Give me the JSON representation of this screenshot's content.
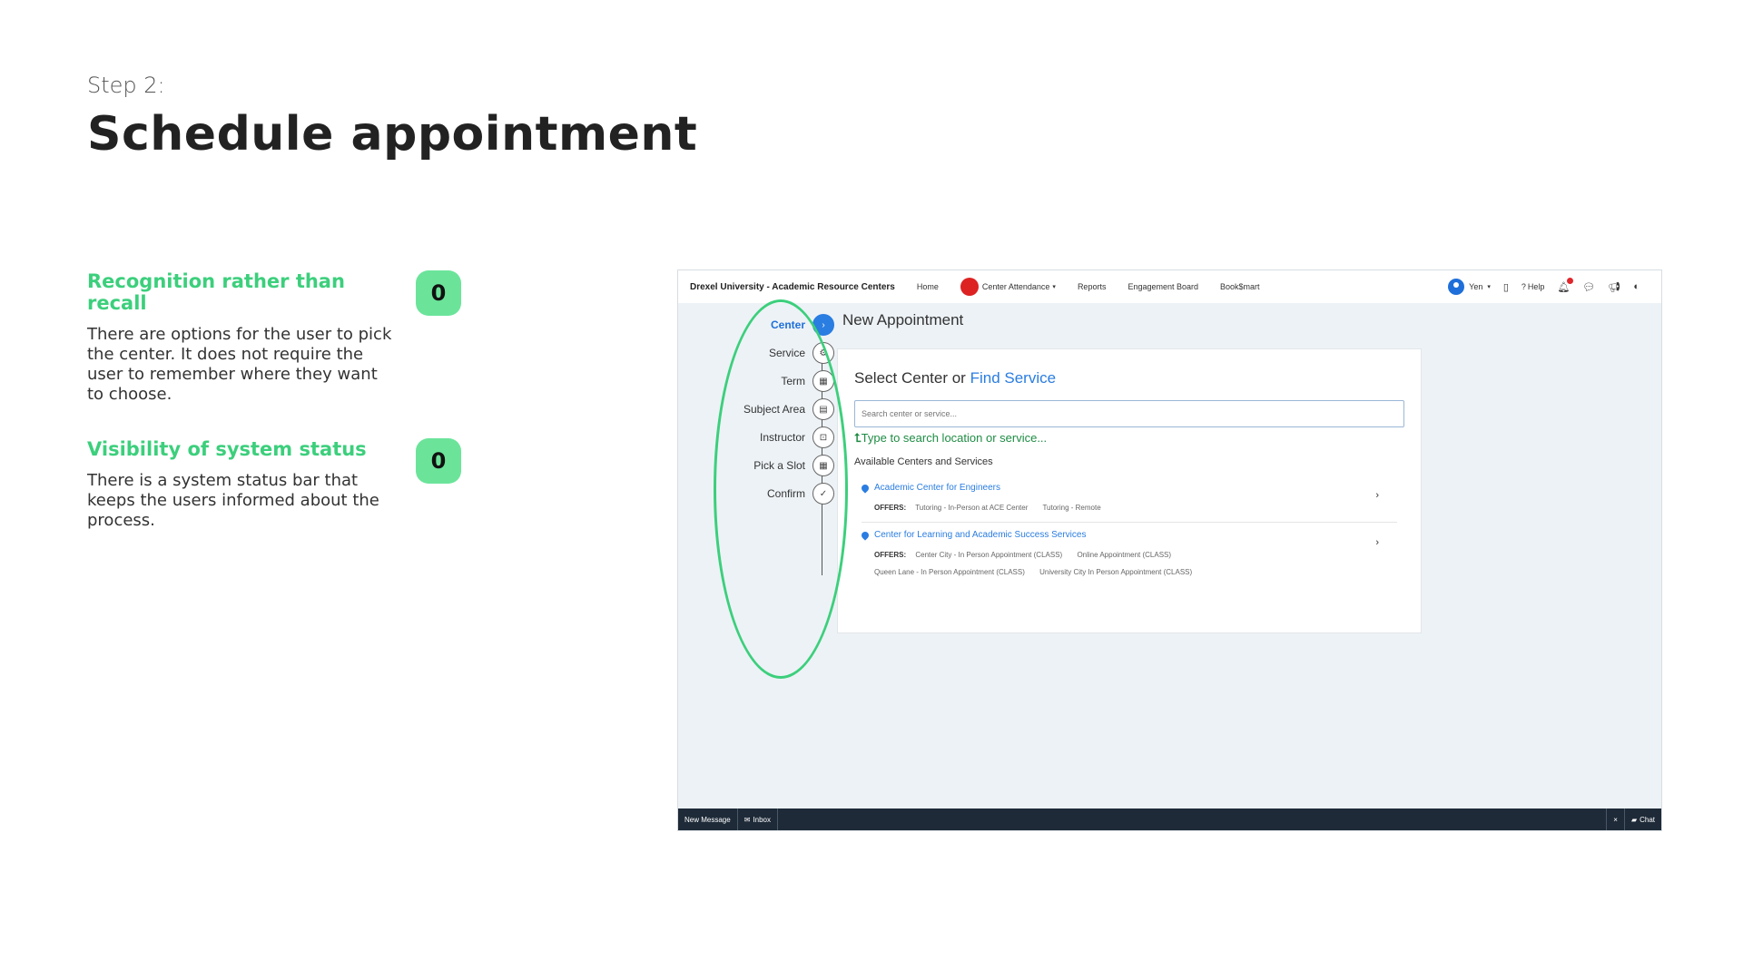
{
  "slide": {
    "step_label": "Step 2:",
    "title": "Schedule appointment"
  },
  "principles": [
    {
      "heading": "Recognition rather than recall",
      "body": "There are options for the user to pick the center. It does not require the user to remember where they want to choose.",
      "score": "0"
    },
    {
      "heading": "Visibility of system status",
      "body": "There is a system status bar that keeps the users informed about the process.",
      "score": "0"
    }
  ],
  "app": {
    "brand": "Drexel University - Academic Resource Centers",
    "nav": {
      "home": "Home",
      "center_attendance": "Center Attendance",
      "reports": "Reports",
      "engagement_board": "Engagement Board",
      "booksmart": "Book$mart"
    },
    "nav_right": {
      "user": "Yen",
      "help": "Help"
    },
    "page_heading": "New Appointment",
    "steps": [
      {
        "label": "Center",
        "icon": "chevron-right-icon",
        "glyph": "›"
      },
      {
        "label": "Service",
        "icon": "service-icon",
        "glyph": "⚙"
      },
      {
        "label": "Term",
        "icon": "calendar-icon",
        "glyph": "▦"
      },
      {
        "label": "Subject Area",
        "icon": "book-icon",
        "glyph": "▤"
      },
      {
        "label": "Instructor",
        "icon": "instructor-icon",
        "glyph": "⊡"
      },
      {
        "label": "Pick a Slot",
        "icon": "calendar-icon",
        "glyph": "▦"
      },
      {
        "label": "Confirm",
        "icon": "check-icon",
        "glyph": "✓"
      }
    ],
    "card": {
      "title_prefix": "Select Center or",
      "title_link": "Find Service",
      "search_placeholder": "Search center or service...",
      "hint": "Type to search location or service...",
      "available_label": "Available Centers and Services",
      "offers_label": "OFFERS:",
      "centers": [
        {
          "name": "Academic Center for Engineers",
          "offers_line1": [
            "Tutoring - In-Person at ACE Center",
            "Tutoring - Remote"
          ],
          "offers_line2": []
        },
        {
          "name": "Center for Learning and Academic Success Services",
          "offers_line1": [
            "Center City - In Person Appointment (CLASS)",
            "Online Appointment (CLASS)"
          ],
          "offers_line2": [
            "Queen Lane - In Person Appointment (CLASS)",
            "University City In Person Appointment (CLASS)"
          ]
        }
      ]
    },
    "bottom_bar": {
      "new_message": "New Message",
      "inbox": "Inbox",
      "close": "×",
      "chat": "Chat"
    }
  },
  "colors": {
    "accent_green": "#3ccf7c",
    "score_bg": "#6be49a",
    "link_blue": "#2a7de1",
    "hint_green": "#1f8c44",
    "bottom_bar": "#1e2a38"
  }
}
